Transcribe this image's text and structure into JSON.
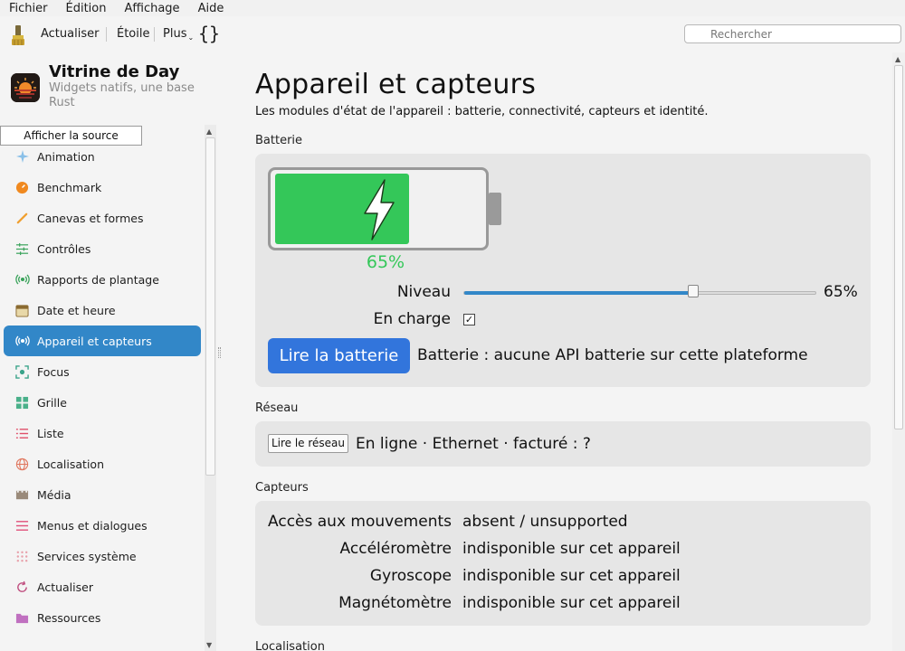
{
  "menubar": {
    "items": [
      "Fichier",
      "Édition",
      "Affichage",
      "Aide"
    ]
  },
  "toolbar": {
    "refresh_label": "Actualiser",
    "star_label": "Étoile",
    "more_label": "Plus",
    "braces_label": "{}",
    "search_placeholder": "Rechercher"
  },
  "sidebar": {
    "app_title": "Vitrine de Day",
    "app_subtitle": "Widgets natifs, une base Rust",
    "source_button": "Afficher la source",
    "items": [
      {
        "label": "Animation",
        "icon": "sparkles-icon",
        "color": "#7cb9e8"
      },
      {
        "label": "Benchmark",
        "icon": "gauge-icon",
        "color": "#f0891f"
      },
      {
        "label": "Canevas et formes",
        "icon": "brush-icon",
        "color": "#f0a030"
      },
      {
        "label": "Contrôles",
        "icon": "sliders-icon",
        "color": "#3aa35b"
      },
      {
        "label": "Rapports de plantage",
        "icon": "broadcast-icon",
        "color": "#3aa35b"
      },
      {
        "label": "Date et heure",
        "icon": "calendar-icon",
        "color": "#8a6a30"
      },
      {
        "label": "Appareil et capteurs",
        "icon": "broadcast-icon",
        "color": "#ffffff",
        "active": true
      },
      {
        "label": "Focus",
        "icon": "focus-icon",
        "color": "#3aa38a"
      },
      {
        "label": "Grille",
        "icon": "grid-icon",
        "color": "#4ab08a"
      },
      {
        "label": "Liste",
        "icon": "list-icon",
        "color": "#e0506a"
      },
      {
        "label": "Localisation",
        "icon": "globe-icon",
        "color": "#e07860"
      },
      {
        "label": "Média",
        "icon": "film-icon",
        "color": "#9a8a7a"
      },
      {
        "label": "Menus et dialogues",
        "icon": "menu-icon",
        "color": "#e0507a"
      },
      {
        "label": "Services système",
        "icon": "dots-grid-icon",
        "color": "#e06a7a"
      },
      {
        "label": "Actualiser",
        "icon": "refresh-icon",
        "color": "#c05080"
      },
      {
        "label": "Ressources",
        "icon": "folder-icon",
        "color": "#c070c0"
      }
    ]
  },
  "main": {
    "title": "Appareil et capteurs",
    "description": "Les modules d'état de l'appareil : batterie, connectivité, capteurs et identité.",
    "battery": {
      "section_label": "Batterie",
      "level_fraction": 0.65,
      "percent_text": "65%",
      "level_label": "Niveau",
      "slider_value": 0.65,
      "slider_value_text": "65%",
      "charging_label": "En charge",
      "charging": true,
      "read_button": "Lire la batterie",
      "status_text": "Batterie : aucune API batterie sur cette plateforme",
      "fill_color": "#34c759"
    },
    "network": {
      "section_label": "Réseau",
      "read_button": "Lire le réseau",
      "status_text": "En ligne · Ethernet · facturé : ?"
    },
    "sensors": {
      "section_label": "Capteurs",
      "rows": [
        {
          "label": "Accès aux mouvements",
          "value": "absent / unsupported"
        },
        {
          "label": "Accéléromètre",
          "value": "indisponible sur cet appareil"
        },
        {
          "label": "Gyroscope",
          "value": "indisponible sur cet appareil"
        },
        {
          "label": "Magnétomètre",
          "value": "indisponible sur cet appareil"
        }
      ]
    },
    "location": {
      "section_label": "Localisation"
    }
  },
  "colors": {
    "accent": "#3287c8",
    "primary_button": "#3275dc"
  }
}
